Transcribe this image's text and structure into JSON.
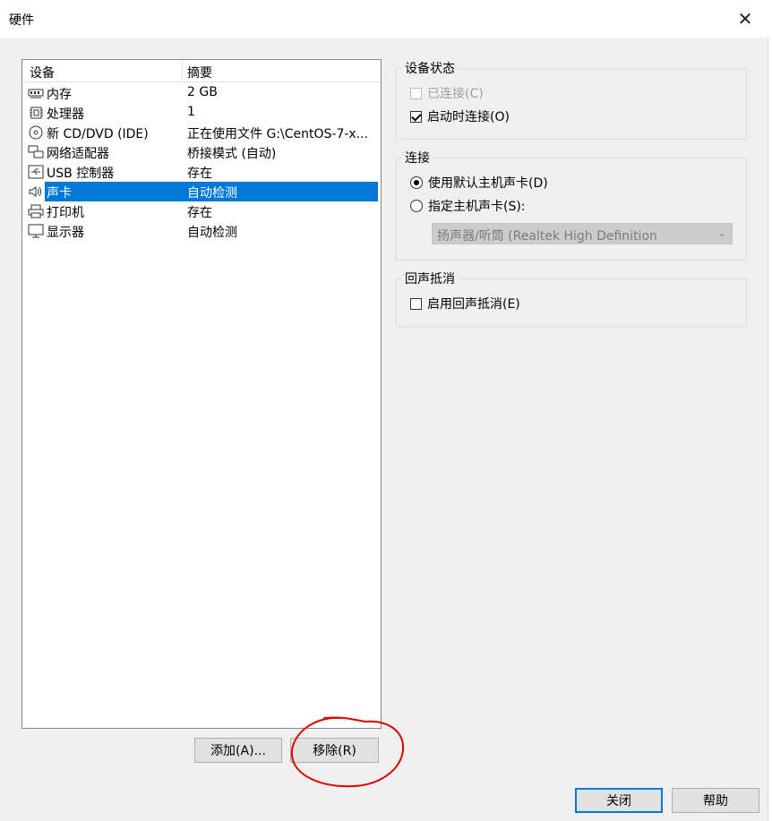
{
  "window": {
    "title": "硬件",
    "close_glyph": "✕"
  },
  "devices": {
    "header": {
      "device": "设备",
      "summary": "摘要"
    },
    "rows": [
      {
        "icon": "memory-icon",
        "name": "内存",
        "summary": "2 GB"
      },
      {
        "icon": "processor-icon",
        "name": "处理器",
        "summary": "1"
      },
      {
        "icon": "cd-dvd-icon",
        "name": "新 CD/DVD (IDE)",
        "summary": "正在使用文件 G:\\CentOS-7-x..."
      },
      {
        "icon": "network-adapter-icon",
        "name": "网络适配器",
        "summary": "桥接模式 (自动)"
      },
      {
        "icon": "usb-icon",
        "name": "USB 控制器",
        "summary": "存在"
      },
      {
        "icon": "sound-card-icon",
        "name": "声卡",
        "summary": "自动检测",
        "selected": true
      },
      {
        "icon": "printer-icon",
        "name": "打印机",
        "summary": "存在"
      },
      {
        "icon": "display-icon",
        "name": "显示器",
        "summary": "自动检测"
      }
    ],
    "add_label": "添加(A)...",
    "remove_label": "移除(R)"
  },
  "device_status": {
    "title": "设备状态",
    "connected_label": "已连接(C)",
    "connected_checked": false,
    "connected_enabled": false,
    "connect_at_power_on_label": "启动时连接(O)",
    "connect_at_power_on_checked": true
  },
  "connection": {
    "title": "连接",
    "use_default_label": "使用默认主机声卡(D)",
    "use_default_selected": true,
    "specify_label": "指定主机声卡(S):",
    "specify_selected": false,
    "selected_device": "扬声器/听筒 (Realtek High Definition"
  },
  "echo_cancellation": {
    "title": "回声抵消",
    "enable_label": "启用回声抵消(E)",
    "enable_checked": false
  },
  "footer": {
    "close_label": "关闭",
    "help_label": "帮助"
  },
  "colors": {
    "selection": "#0078d7",
    "annotation": "#e00000"
  }
}
